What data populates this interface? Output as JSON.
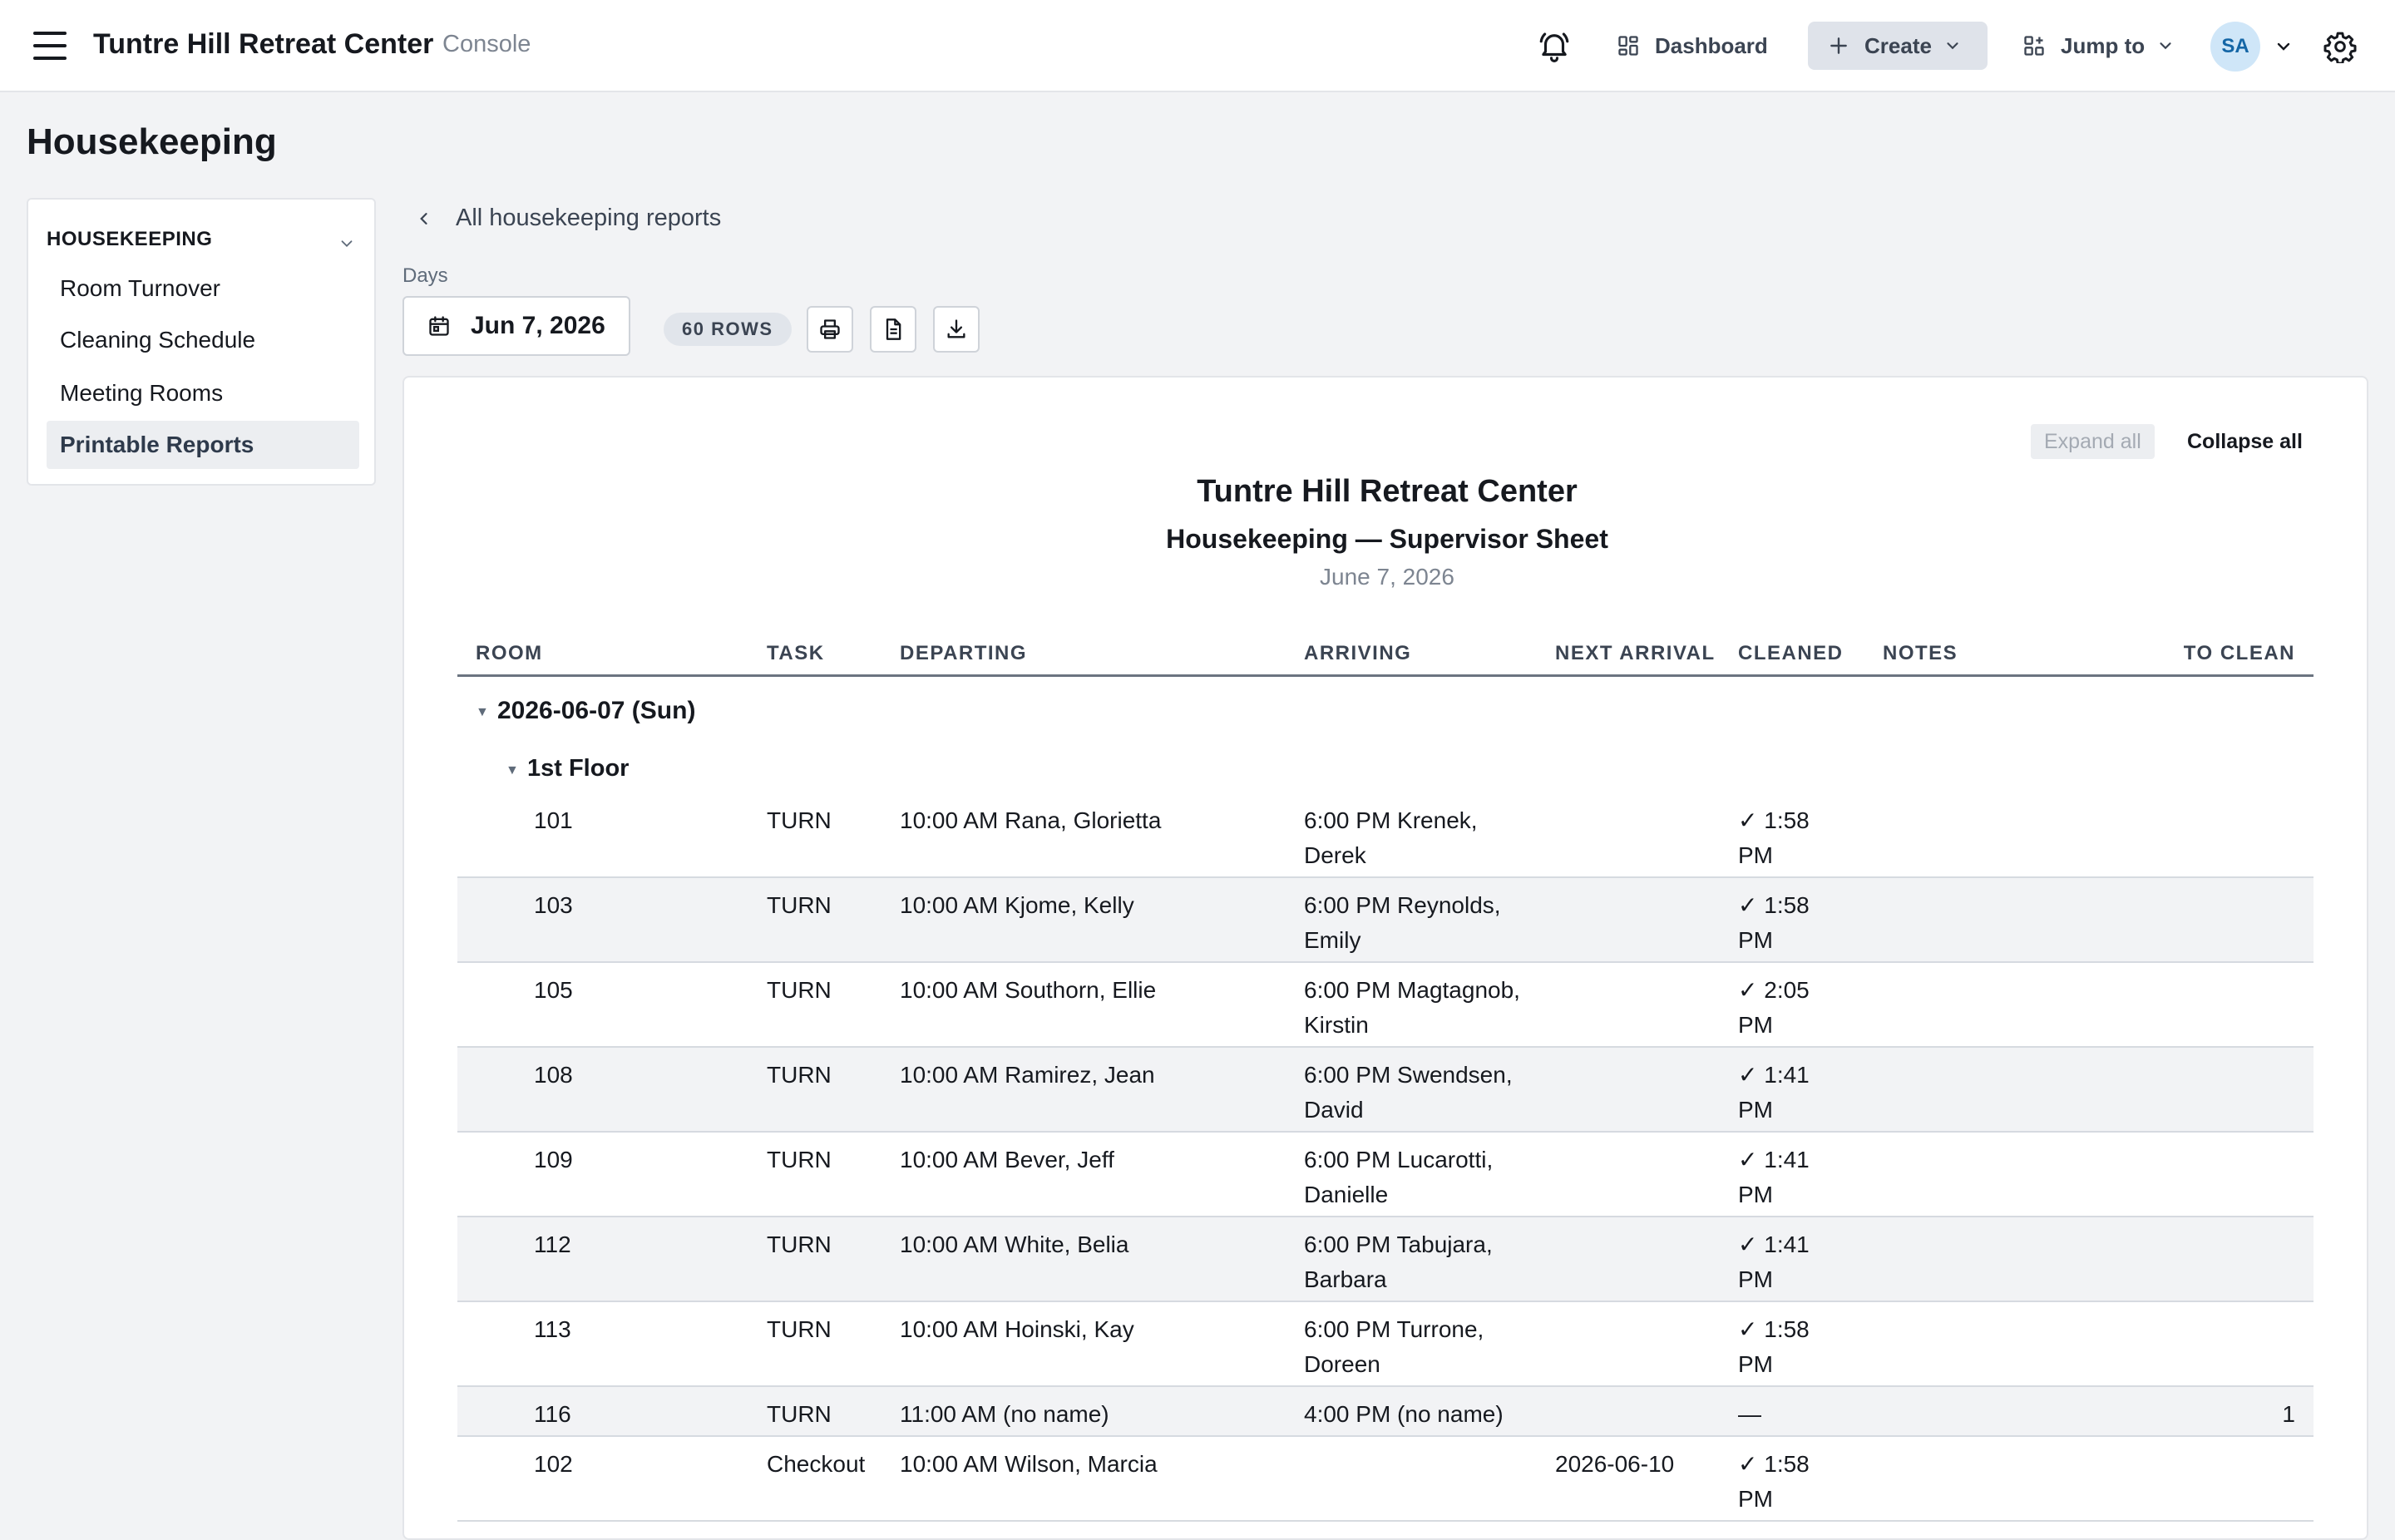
{
  "app": {
    "title": "Tuntre Hill Retreat Center",
    "subtitle": "Console"
  },
  "topnav": {
    "dashboard": "Dashboard",
    "create": "Create",
    "jump_to": "Jump to",
    "avatar": "SA"
  },
  "page": {
    "title": "Housekeeping"
  },
  "sidebar": {
    "heading": "HOUSEKEEPING",
    "items": [
      {
        "label": "Room Turnover"
      },
      {
        "label": "Cleaning Schedule"
      },
      {
        "label": "Meeting Rooms"
      },
      {
        "label": "Printable Reports",
        "active": true
      }
    ]
  },
  "controls": {
    "back_label": "All housekeeping reports",
    "days_label": "Days",
    "date_value": "Jun 7, 2026",
    "rows_badge": "60 ROWS",
    "icons": [
      "printer-icon",
      "document-icon",
      "download-icon"
    ]
  },
  "report": {
    "expand_all": "Expand all",
    "collapse_all": "Collapse all",
    "org": "Tuntre Hill Retreat Center",
    "title": "Housekeeping — Supervisor Sheet",
    "date": "June 7, 2026",
    "columns": [
      "ROOM",
      "TASK",
      "DEPARTING",
      "ARRIVING",
      "NEXT ARRIVAL",
      "CLEANED",
      "NOTES",
      "TO CLEAN"
    ],
    "day_group": "2026-06-07 (Sun)",
    "floor_group": "1st Floor",
    "rows": [
      {
        "room": "101",
        "task": "TURN",
        "departing": "10:00 AM Rana, Glorietta",
        "arriving": "6:00 PM Krenek, Derek",
        "next": "",
        "cleaned": "✓ 1:58 PM",
        "to_clean": ""
      },
      {
        "room": "103",
        "task": "TURN",
        "departing": "10:00 AM Kjome, Kelly",
        "arriving": "6:00 PM Reynolds, Emily",
        "next": "",
        "cleaned": "✓ 1:58 PM",
        "to_clean": ""
      },
      {
        "room": "105",
        "task": "TURN",
        "departing": "10:00 AM Southorn, Ellie",
        "arriving": "6:00 PM Magtagnob, Kirstin",
        "next": "",
        "cleaned": "✓ 2:05 PM",
        "to_clean": ""
      },
      {
        "room": "108",
        "task": "TURN",
        "departing": "10:00 AM Ramirez, Jean",
        "arriving": "6:00 PM Swendsen, David",
        "next": "",
        "cleaned": "✓ 1:41 PM",
        "to_clean": ""
      },
      {
        "room": "109",
        "task": "TURN",
        "departing": "10:00 AM Bever, Jeff",
        "arriving": "6:00 PM Lucarotti, Danielle",
        "next": "",
        "cleaned": "✓ 1:41 PM",
        "to_clean": ""
      },
      {
        "room": "112",
        "task": "TURN",
        "departing": "10:00 AM White, Belia",
        "arriving": "6:00 PM Tabujara, Barbara",
        "next": "",
        "cleaned": "✓ 1:41 PM",
        "to_clean": ""
      },
      {
        "room": "113",
        "task": "TURN",
        "departing": "10:00 AM Hoinski, Kay",
        "arriving": "6:00 PM Turrone, Doreen",
        "next": "",
        "cleaned": "✓ 1:58 PM",
        "to_clean": ""
      },
      {
        "room": "116",
        "task": "TURN",
        "departing": "11:00 AM (no name)",
        "arriving": "4:00 PM (no name)",
        "next": "",
        "cleaned": "—",
        "to_clean": "1"
      },
      {
        "room": "102",
        "task": "Checkout",
        "departing": "10:00 AM Wilson, Marcia",
        "arriving": "",
        "next": "2026-06-10",
        "cleaned": "✓ 1:58 PM",
        "to_clean": ""
      }
    ]
  }
}
